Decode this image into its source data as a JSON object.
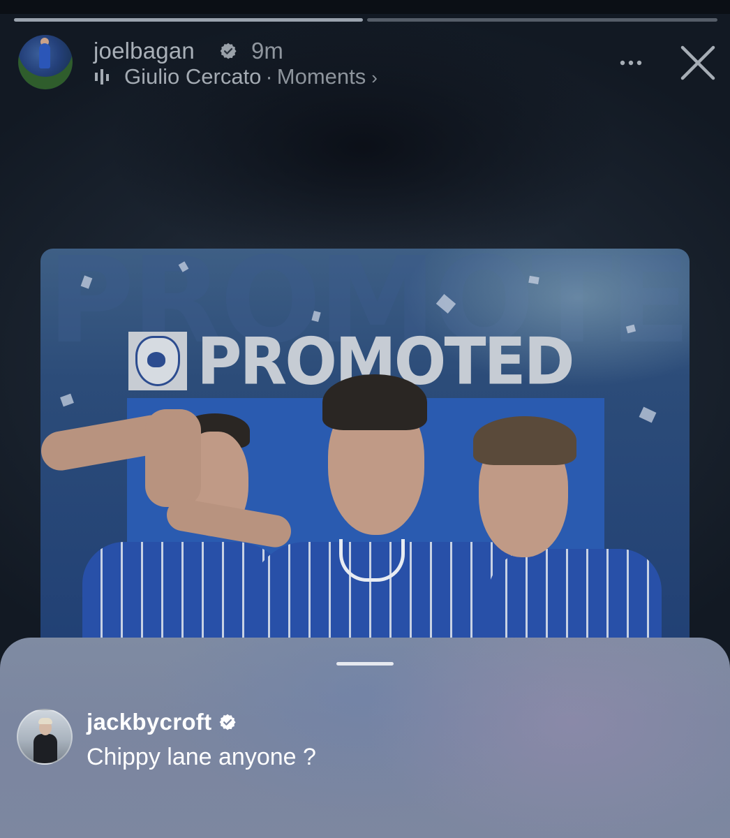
{
  "story": {
    "username": "joelbagan",
    "time": "9m",
    "music": {
      "artist": "Giulio Cercato",
      "separator": "·",
      "title": "Moments",
      "chevron": "›"
    },
    "icons": {
      "verified": "verified-badge-icon",
      "music": "music-bars-icon",
      "more": "more-options-icon",
      "close": "close-icon"
    }
  },
  "post": {
    "banner_text": "PROMOTED",
    "background_letters": "PROMOTED"
  },
  "comment": {
    "username": "jackbycroft",
    "text": "Chippy lane anyone ?"
  },
  "colors": {
    "sheet": "#7d87a0",
    "text_primary": "#ffffff",
    "text_muted": "#a9b0b8",
    "club_blue": "#2850a8"
  }
}
